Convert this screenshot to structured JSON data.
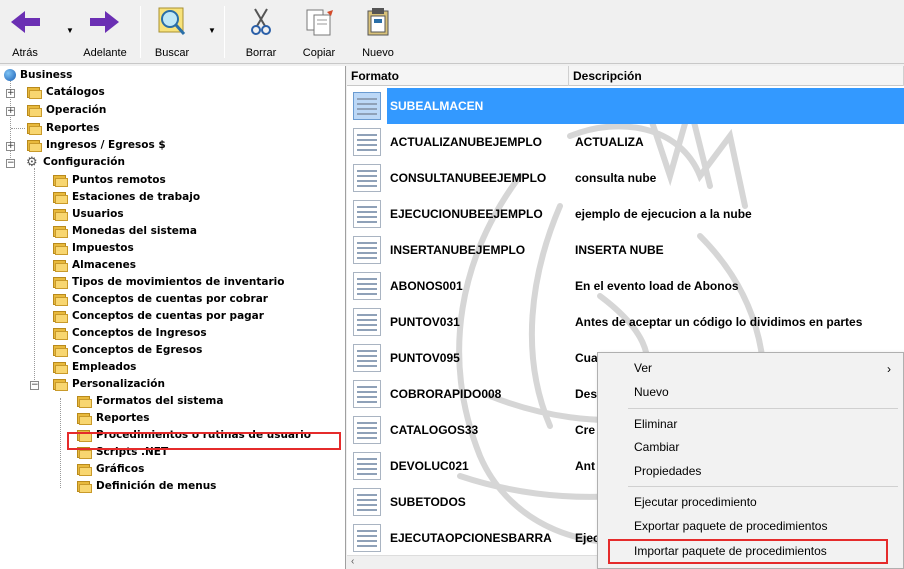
{
  "toolbar": {
    "back_label": "Atrás",
    "forward_label": "Adelante",
    "search_label": "Buscar",
    "delete_label": "Borrar",
    "copy_label": "Copiar",
    "new_label": "Nuevo"
  },
  "tree": {
    "root": "Business",
    "items": [
      "Catálogos",
      "Operación",
      "Reportes",
      "Ingresos / Egresos $",
      "Configuración",
      "Puntos remotos",
      "Estaciones de trabajo",
      "Usuarios",
      "Monedas del sistema",
      "Impuestos",
      "Almacenes",
      "Tipos de movimientos de inventario",
      "Conceptos de cuentas por cobrar",
      "Conceptos de cuentas por pagar",
      "Conceptos de Ingresos",
      "Conceptos de Egresos",
      "Empleados",
      "Personalización",
      "Formatos del sistema",
      "Reportes",
      "Procedimientos o rutinas de usuario",
      "Scripts .NET",
      "Gráficos",
      "Definición de menus"
    ]
  },
  "list": {
    "col_format": "Formato",
    "col_description": "Descripción",
    "rows": [
      {
        "format": "SUBEALMACEN",
        "description": ""
      },
      {
        "format": "ACTUALIZANUBEJEMPLO",
        "description": "ACTUALIZA"
      },
      {
        "format": "CONSULTANUBEEJEMPLO",
        "description": "consulta nube"
      },
      {
        "format": "EJECUCIONUBEEJEMPLO",
        "description": "ejemplo de ejecucion a la nube"
      },
      {
        "format": "INSERTANUBEJEMPLO",
        "description": "INSERTA NUBE"
      },
      {
        "format": "ABONOS001",
        "description": "En el evento load de Abonos"
      },
      {
        "format": "PUNTOV031",
        "description": "Antes de aceptar un código lo dividimos en partes"
      },
      {
        "format": "PUNTOV095",
        "description": "Cua"
      },
      {
        "format": "COBRORAPIDO008",
        "description": "Des"
      },
      {
        "format": "CATALOGOS33",
        "description": "Cre"
      },
      {
        "format": "DEVOLUC021",
        "description": "Ant"
      },
      {
        "format": "SUBETODOS",
        "description": ""
      },
      {
        "format": "EJECUTAOPCIONESBARRA",
        "description": "Ejec"
      }
    ]
  },
  "context_menu": {
    "items": [
      "Ver",
      "Nuevo",
      "Eliminar",
      "Cambiar",
      "Propiedades",
      "Ejecutar procedimiento",
      "Exportar paquete de procedimientos",
      "Importar paquete de procedimientos"
    ]
  },
  "colors": {
    "selection": "#3399ff",
    "highlight_box": "#e52b2b",
    "arrow": "#6b2fb3"
  }
}
